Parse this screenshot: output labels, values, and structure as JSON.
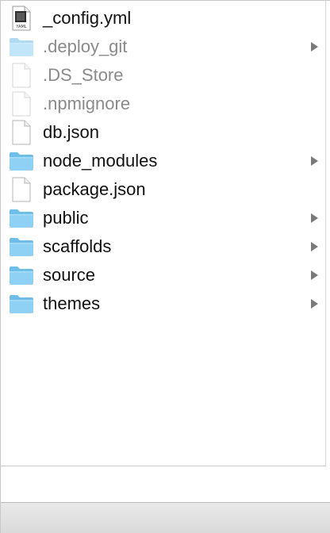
{
  "files": [
    {
      "name": "_config.yml",
      "type": "yaml-file",
      "icon": "yaml-file-icon",
      "hidden": false,
      "expandable": false
    },
    {
      "name": ".deploy_git",
      "type": "folder",
      "icon": "folder-icon",
      "hidden": true,
      "expandable": true
    },
    {
      "name": ".DS_Store",
      "type": "file",
      "icon": "document-icon",
      "hidden": true,
      "expandable": false
    },
    {
      "name": ".npmignore",
      "type": "file",
      "icon": "document-icon",
      "hidden": true,
      "expandable": false
    },
    {
      "name": "db.json",
      "type": "file",
      "icon": "document-icon",
      "hidden": false,
      "expandable": false
    },
    {
      "name": "node_modules",
      "type": "folder",
      "icon": "folder-icon",
      "hidden": false,
      "expandable": true
    },
    {
      "name": "package.json",
      "type": "file",
      "icon": "document-icon",
      "hidden": false,
      "expandable": false
    },
    {
      "name": "public",
      "type": "folder",
      "icon": "folder-icon",
      "hidden": false,
      "expandable": true
    },
    {
      "name": "scaffolds",
      "type": "folder",
      "icon": "folder-icon",
      "hidden": false,
      "expandable": true
    },
    {
      "name": "source",
      "type": "folder",
      "icon": "folder-icon",
      "hidden": false,
      "expandable": true
    },
    {
      "name": "themes",
      "type": "folder",
      "icon": "folder-icon",
      "hidden": false,
      "expandable": true
    }
  ],
  "yaml_badge": "YAML",
  "colors": {
    "folder_fill": "#8fd0f5",
    "folder_tab": "#6fbde9",
    "label_text": "#111111",
    "hidden_text": "#8a8a8a",
    "chevron": "#7a7a7a"
  }
}
